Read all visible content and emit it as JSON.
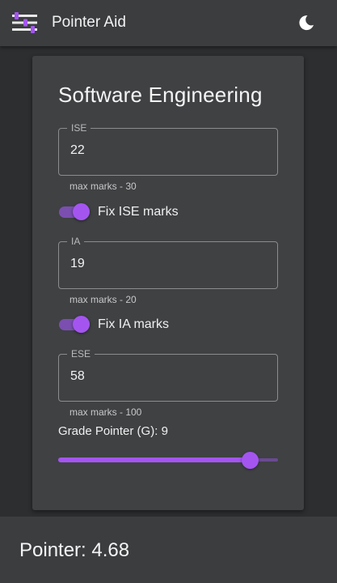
{
  "appbar": {
    "title": "Pointer Aid",
    "menu_icon": "sliders-icon",
    "theme_icon": "moon-icon"
  },
  "card": {
    "title": "Software Engineering",
    "fields": {
      "ise": {
        "label": "ISE",
        "value": "22",
        "helper": "max marks - 30"
      },
      "ia": {
        "label": "IA",
        "value": "19",
        "helper": "max marks - 20"
      },
      "ese": {
        "label": "ESE",
        "value": "58",
        "helper": "max marks - 100"
      }
    },
    "toggles": {
      "fix_ise": {
        "label": "Fix ISE marks",
        "on": true
      },
      "fix_ia": {
        "label": "Fix IA marks",
        "on": true
      }
    },
    "grade": {
      "label": "Grade Pointer (G):",
      "value": "9",
      "slider_min": 0,
      "slider_max": 10,
      "slider_value": 9
    }
  },
  "footer": {
    "label": "Pointer:",
    "value": "4.68"
  },
  "colors": {
    "accent": "#a455f0",
    "accent_track": "#7a4fb0",
    "appbar": "#3b3d3f",
    "card": "#3f4143",
    "background": "#2c2e30"
  }
}
